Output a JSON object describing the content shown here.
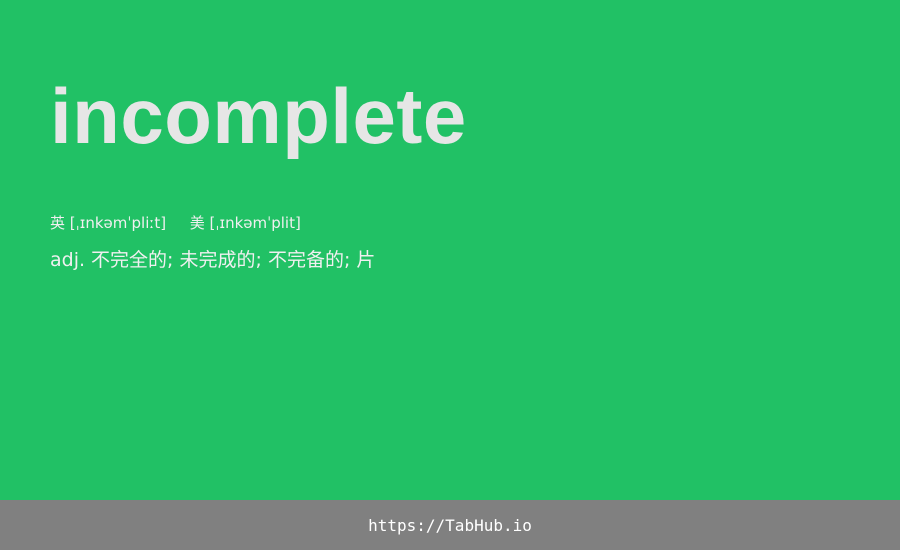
{
  "word": "incomplete",
  "phonetics": {
    "uk_label": "英",
    "uk_ipa": "[ˌɪnkəmˈpliːt]",
    "us_label": "美",
    "us_ipa": "[ˌɪnkəmˈplit]"
  },
  "definition": "adj. 不完全的; 未完成的; 不完备的; 片",
  "footer": {
    "link_text": "https://TabHub.io"
  },
  "colors": {
    "background": "#21c165",
    "footer": "#808080",
    "word": "#e6e6e6"
  }
}
